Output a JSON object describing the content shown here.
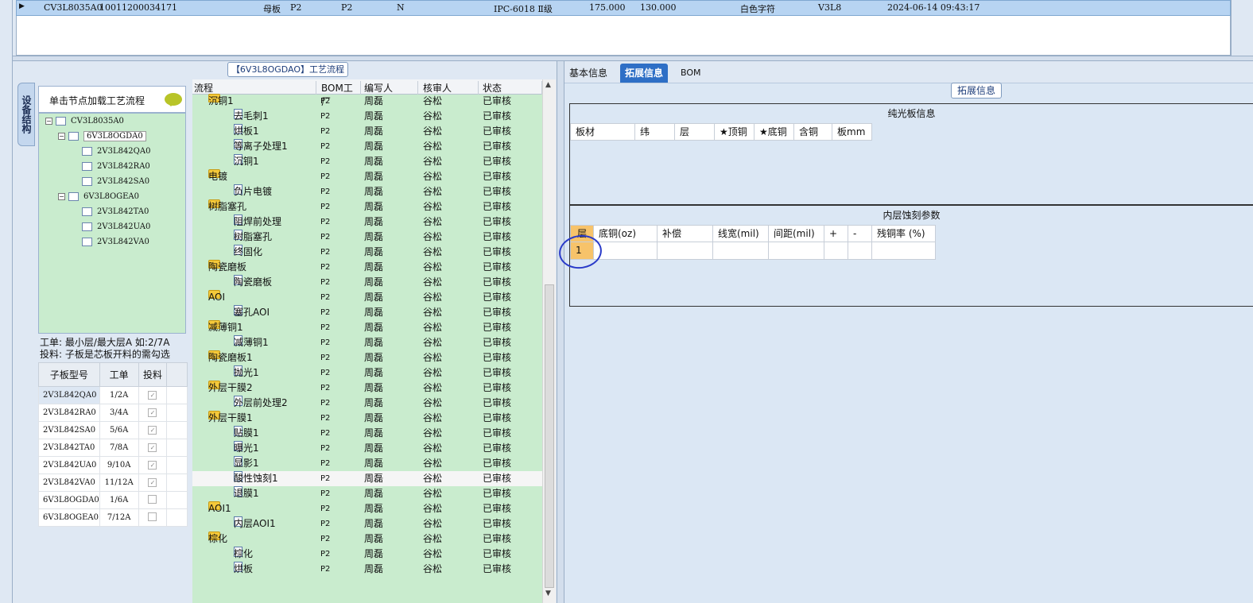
{
  "top_row": {
    "code": "CV3L8035A0",
    "number": "10011200034171",
    "type": "母板",
    "f1": "P2",
    "f2": "P2",
    "f3": "N",
    "material": "IPC-6018 Ⅱ级",
    "dim1": "175.000",
    "dim2": "130.000",
    "text": "白色字符",
    "ver": "V3L8",
    "time": "2024-06-14 09:43:17"
  },
  "process_title": "【6V3L8OGDAO】工艺流程",
  "vertical_tab": "设备结构",
  "tree_header": "单击节点加载工艺流程",
  "tree": [
    {
      "label": "CV3L8035A0",
      "level": 0
    },
    {
      "label": "6V3L8OGDA0",
      "level": 1
    },
    {
      "label": "2V3L842QA0",
      "level": 2
    },
    {
      "label": "2V3L842RA0",
      "level": 2
    },
    {
      "label": "2V3L842SA0",
      "level": 2
    },
    {
      "label": "6V3L8OGEA0",
      "level": 1
    },
    {
      "label": "2V3L842TA0",
      "level": 2
    },
    {
      "label": "2V3L842UA0",
      "level": 2
    },
    {
      "label": "2V3L842VA0",
      "level": 2
    }
  ],
  "hint_line1": "工单: 最小层/最大层A 如:2/7A",
  "hint_line2": "投料: 子板是芯板开料的需勾选",
  "sub_table": {
    "headers": [
      "子板型号",
      "工单",
      "投料"
    ],
    "rows": [
      {
        "model": "2V3L842QA0",
        "order": "1/2A",
        "checked": true
      },
      {
        "model": "2V3L842RA0",
        "order": "3/4A",
        "checked": true
      },
      {
        "model": "2V3L842SA0",
        "order": "5/6A",
        "checked": true
      },
      {
        "model": "2V3L842TA0",
        "order": "7/8A",
        "checked": true
      },
      {
        "model": "2V3L842UA0",
        "order": "9/10A",
        "checked": true
      },
      {
        "model": "2V3L842VA0",
        "order": "11/12A",
        "checked": true
      },
      {
        "model": "6V3L8OGDA0",
        "order": "1/6A",
        "checked": false
      },
      {
        "model": "6V3L8OGEA0",
        "order": "7/12A",
        "checked": false
      }
    ]
  },
  "grid_headers": [
    "流程",
    "BOM工厂",
    "编写人",
    "核审人",
    "状态"
  ],
  "grid_rows": [
    {
      "name": "沉铜1",
      "folder": true,
      "f": "P2",
      "w": "周磊",
      "r": "谷松",
      "s": "已审核"
    },
    {
      "name": "去毛刺1",
      "folder": false,
      "f": "P2",
      "w": "周磊",
      "r": "谷松",
      "s": "已审核"
    },
    {
      "name": "烘板1",
      "folder": false,
      "f": "P2",
      "w": "周磊",
      "r": "谷松",
      "s": "已审核"
    },
    {
      "name": "等离子处理1",
      "folder": false,
      "f": "P2",
      "w": "周磊",
      "r": "谷松",
      "s": "已审核"
    },
    {
      "name": "沉铜1",
      "folder": false,
      "f": "P2",
      "w": "周磊",
      "r": "谷松",
      "s": "已审核"
    },
    {
      "name": "电镀",
      "folder": true,
      "f": "P2",
      "w": "周磊",
      "r": "谷松",
      "s": "已审核"
    },
    {
      "name": "负片电镀",
      "folder": false,
      "f": "P2",
      "w": "周磊",
      "r": "谷松",
      "s": "已审核"
    },
    {
      "name": "树脂塞孔",
      "folder": true,
      "f": "P2",
      "w": "周磊",
      "r": "谷松",
      "s": "已审核"
    },
    {
      "name": "阻焊前处理",
      "folder": false,
      "f": "P2",
      "w": "周磊",
      "r": "谷松",
      "s": "已审核"
    },
    {
      "name": "树脂塞孔",
      "folder": false,
      "f": "P2",
      "w": "周磊",
      "r": "谷松",
      "s": "已审核"
    },
    {
      "name": "终固化",
      "folder": false,
      "f": "P2",
      "w": "周磊",
      "r": "谷松",
      "s": "已审核"
    },
    {
      "name": "陶瓷磨板",
      "folder": true,
      "f": "P2",
      "w": "周磊",
      "r": "谷松",
      "s": "已审核"
    },
    {
      "name": "陶瓷磨板",
      "folder": false,
      "f": "P2",
      "w": "周磊",
      "r": "谷松",
      "s": "已审核"
    },
    {
      "name": "AOI",
      "folder": true,
      "f": "P2",
      "w": "周磊",
      "r": "谷松",
      "s": "已审核"
    },
    {
      "name": "塞孔AOI",
      "folder": false,
      "f": "P2",
      "w": "周磊",
      "r": "谷松",
      "s": "已审核"
    },
    {
      "name": "减薄铜1",
      "folder": true,
      "f": "P2",
      "w": "周磊",
      "r": "谷松",
      "s": "已审核"
    },
    {
      "name": "减薄铜1",
      "folder": false,
      "f": "P2",
      "w": "周磊",
      "r": "谷松",
      "s": "已审核"
    },
    {
      "name": "陶瓷磨板1",
      "folder": true,
      "f": "P2",
      "w": "周磊",
      "r": "谷松",
      "s": "已审核"
    },
    {
      "name": "抛光1",
      "folder": false,
      "f": "P2",
      "w": "周磊",
      "r": "谷松",
      "s": "已审核"
    },
    {
      "name": "外层干膜2",
      "folder": true,
      "f": "P2",
      "w": "周磊",
      "r": "谷松",
      "s": "已审核"
    },
    {
      "name": "外层前处理2",
      "folder": false,
      "f": "P2",
      "w": "周磊",
      "r": "谷松",
      "s": "已审核"
    },
    {
      "name": "外层干膜1",
      "folder": true,
      "f": "P2",
      "w": "周磊",
      "r": "谷松",
      "s": "已审核"
    },
    {
      "name": "贴膜1",
      "folder": false,
      "f": "P2",
      "w": "周磊",
      "r": "谷松",
      "s": "已审核"
    },
    {
      "name": "曝光1",
      "folder": false,
      "f": "P2",
      "w": "周磊",
      "r": "谷松",
      "s": "已审核"
    },
    {
      "name": "显影1",
      "folder": false,
      "f": "P2",
      "w": "周磊",
      "r": "谷松",
      "s": "已审核"
    },
    {
      "name": "酸性蚀刻1",
      "folder": false,
      "f": "P2",
      "w": "周磊",
      "r": "谷松",
      "s": "已审核",
      "hl": true
    },
    {
      "name": "退膜1",
      "folder": false,
      "f": "P2",
      "w": "周磊",
      "r": "谷松",
      "s": "已审核"
    },
    {
      "name": "AOI1",
      "folder": true,
      "f": "P2",
      "w": "周磊",
      "r": "谷松",
      "s": "已审核"
    },
    {
      "name": "内层AOI1",
      "folder": false,
      "f": "P2",
      "w": "周磊",
      "r": "谷松",
      "s": "已审核"
    },
    {
      "name": "棕化",
      "folder": true,
      "f": "P2",
      "w": "周磊",
      "r": "谷松",
      "s": "已审核"
    },
    {
      "name": "棕化",
      "folder": false,
      "f": "P2",
      "w": "周磊",
      "r": "谷松",
      "s": "已审核"
    },
    {
      "name": "烘板",
      "folder": false,
      "f": "P2",
      "w": "周磊",
      "r": "谷松",
      "s": "已审核"
    }
  ],
  "right_tabs": [
    "基本信息",
    "拓展信息",
    "BOM"
  ],
  "right_title": "拓展信息",
  "section1": {
    "title": "纯光板信息",
    "headers": [
      "板材",
      "纬",
      "层",
      "★顶铜",
      "★底铜",
      "含铜",
      "板mm"
    ]
  },
  "section2": {
    "title": "内层蚀刻参数",
    "headers": [
      "层",
      "底铜(oz)",
      "补偿",
      "线宽(mil)",
      "间距(mil)",
      "+",
      "-",
      "残铜率 (%)"
    ],
    "row1_layer": "1"
  }
}
